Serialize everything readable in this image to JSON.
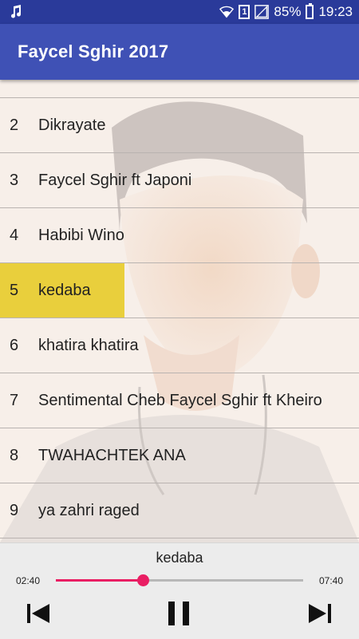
{
  "status_bar": {
    "battery": "85%",
    "time": "19:23",
    "sim": "1",
    "icons": [
      "music-note-icon",
      "wifi-icon",
      "sim-icon",
      "signal-icon",
      "battery-icon"
    ]
  },
  "app_bar": {
    "title": "Faycel Sghir 2017"
  },
  "tracks": [
    {
      "num": "2",
      "title": "Dikrayate"
    },
    {
      "num": "3",
      "title": "Faycel Sghir ft Japoni"
    },
    {
      "num": "4",
      "title": "Habibi Wino"
    },
    {
      "num": "5",
      "title": "kedaba"
    },
    {
      "num": "6",
      "title": "khatira khatira"
    },
    {
      "num": "7",
      "title": "Sentimental Cheb Faycel Sghir ft Kheiro"
    },
    {
      "num": "8",
      "title": "TWAHACHTEK ANA"
    },
    {
      "num": "9",
      "title": "ya zahri raged"
    }
  ],
  "active_track": "5",
  "player": {
    "now_playing": "kedaba",
    "elapsed": "02:40",
    "duration": "07:40",
    "progress_fraction": 0.35,
    "accent_color": "#e91e63",
    "highlight_color": "#e9cf3c"
  }
}
